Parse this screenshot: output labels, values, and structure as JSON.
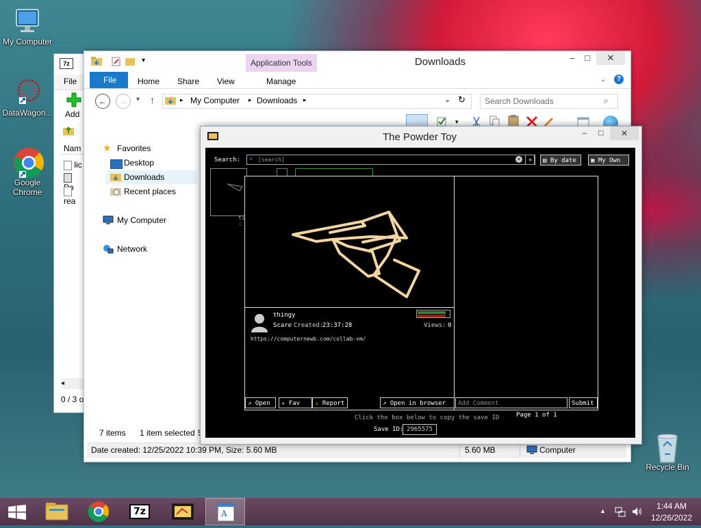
{
  "desktop": {
    "icons": [
      {
        "label": "My Computer"
      },
      {
        "label": "DataWagon..."
      },
      {
        "label": "Google Chrome"
      },
      {
        "label": "Recycle Bin"
      }
    ]
  },
  "sevenzip_window": {
    "menu_file": "File",
    "add_label": "Add",
    "list_header": "Nam",
    "rows": [
      "lic",
      "Po",
      "rea"
    ],
    "status": "0 / 3 o"
  },
  "explorer": {
    "title": "Downloads",
    "context_tab": "Application Tools",
    "tabs": [
      "File",
      "Home",
      "Share",
      "View",
      "Manage"
    ],
    "breadcrumb": [
      "My Computer",
      "Downloads"
    ],
    "search_placeholder": "Search Downloads",
    "nav": {
      "favorites": "Favorites",
      "desktop": "Desktop",
      "downloads": "Downloads",
      "recent": "Recent places",
      "computer": "My Computer",
      "network": "Network"
    },
    "status_items": "7 items",
    "status_selected": "1 item selected",
    "status_selected_size": "5",
    "details_left": "Date created: 12/25/2022 10:39 PM, Size: 5.60 MB",
    "details_size": "5.60 MB",
    "details_location": "Computer"
  },
  "powder_toy": {
    "title": "The Powder Toy",
    "search_label": "Search:",
    "search_placeholder": "[search]",
    "sort_button": "By date",
    "own_button": "My Own",
    "save": {
      "name": "thingy",
      "author": "Scare",
      "created_label": "Created:",
      "created_time": "23:37:28",
      "views_label": "Views:",
      "views": "0",
      "description": "https://computernewb.com/collab-vm/",
      "score_up": 0.9,
      "score_down": 0.1
    },
    "buttons": {
      "open": "Open",
      "fav": "Fav",
      "report": "Report",
      "open_browser": "Open in browser",
      "add_comment": "Add Comment",
      "submit": "Submit"
    },
    "page_label": "Page 1 of 1",
    "copy_hint": "Click the box below to copy the save ID",
    "save_id_label": "Save ID:",
    "save_id": "2965575",
    "thumb_label_1": "ti",
    "thumb_label_2": "c"
  },
  "taskbar": {
    "time": "1:44 AM",
    "date": "12/26/2022"
  }
}
